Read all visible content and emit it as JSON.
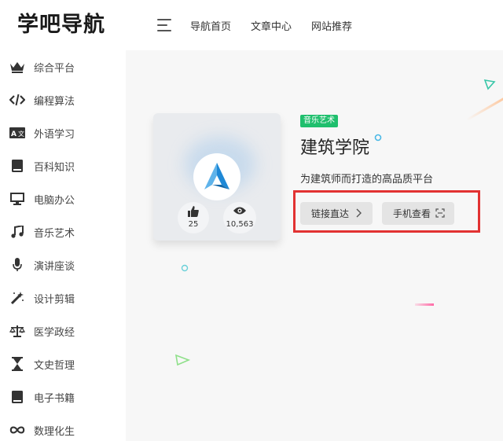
{
  "header": {
    "logo_text": "学吧导航",
    "nav": [
      "导航首页",
      "文章中心",
      "网站推荐"
    ]
  },
  "sidebar": {
    "items": [
      {
        "label": "综合平台",
        "icon": "crown-icon"
      },
      {
        "label": "编程算法",
        "icon": "code-icon"
      },
      {
        "label": "外语学习",
        "icon": "translate-icon"
      },
      {
        "label": "百科知识",
        "icon": "book-icon"
      },
      {
        "label": "电脑办公",
        "icon": "monitor-icon"
      },
      {
        "label": "音乐艺术",
        "icon": "music-note-icon"
      },
      {
        "label": "演讲座谈",
        "icon": "microphone-icon"
      },
      {
        "label": "设计剪辑",
        "icon": "magic-wand-icon"
      },
      {
        "label": "医学政经",
        "icon": "balance-scale-icon"
      },
      {
        "label": "文史哲理",
        "icon": "hourglass-icon"
      },
      {
        "label": "电子书籍",
        "icon": "book-icon"
      },
      {
        "label": "数理化生",
        "icon": "infinity-icon"
      }
    ]
  },
  "site": {
    "category_badge": "音乐艺术",
    "title": "建筑学院",
    "description": "为建筑师而打造的高品质平台",
    "likes": "25",
    "views": "10,563",
    "link_button": "链接直达",
    "mobile_button": "手机查看"
  },
  "colors": {
    "badge": "#1fbf6d",
    "highlight": "#e23232",
    "logo_blue": "#1e88d6"
  }
}
